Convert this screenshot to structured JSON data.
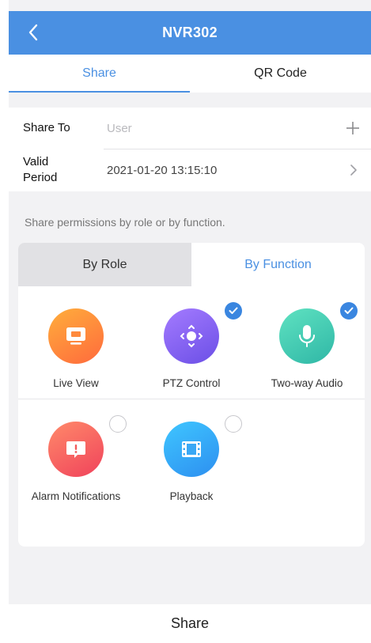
{
  "header": {
    "title": "NVR302",
    "back_icon": "chevron-left-icon"
  },
  "tabs": [
    {
      "label": "Share",
      "active": true
    },
    {
      "label": "QR Code",
      "active": false
    }
  ],
  "form": {
    "share_to_label": "Share To",
    "share_to_placeholder": "User",
    "valid_label_line1": "Valid",
    "valid_label_line2": "Period",
    "valid_value": "2021-01-20 13:15:10"
  },
  "hint": "Share permissions by role or by function.",
  "segment": {
    "role_label": "By Role",
    "function_label": "By Function",
    "selected": "By Function"
  },
  "functions": [
    {
      "label": "Live View",
      "icon": "monitor-icon",
      "checked": false
    },
    {
      "label": "PTZ Control",
      "icon": "ptz-joystick-icon",
      "checked": true
    },
    {
      "label": "Two-way Audio",
      "icon": "microphone-icon",
      "checked": true
    },
    {
      "label": "Alarm Notifications",
      "icon": "alert-message-icon",
      "checked": false
    },
    {
      "label": "Playback",
      "icon": "film-icon",
      "checked": false
    }
  ],
  "bottom": {
    "share_label": "Share"
  },
  "colors": {
    "accent": "#4a90e2",
    "check": "#3a86e0"
  }
}
